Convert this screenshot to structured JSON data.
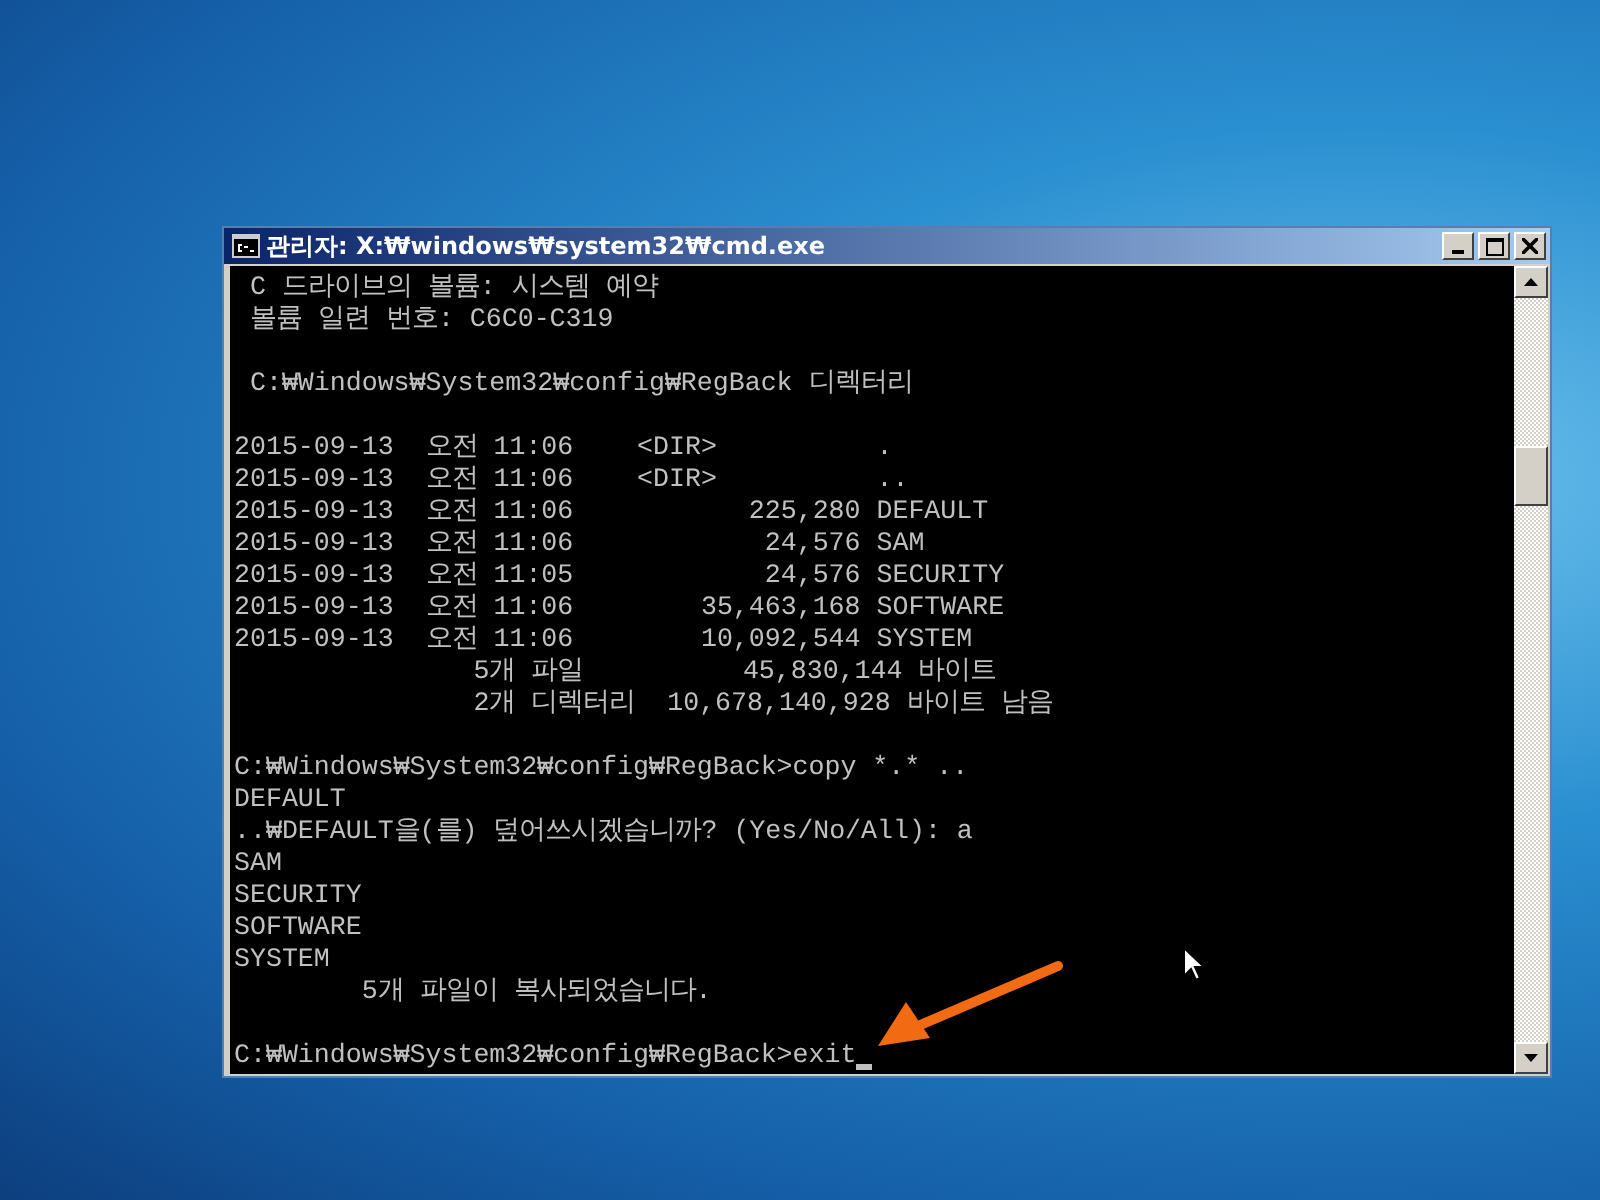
{
  "window": {
    "title": "관리자: X:₩windows₩system32₩cmd.exe"
  },
  "console": {
    "blocks": [
      [
        " C 드라이브의 볼륨: 시스템 예약",
        " 볼륨 일련 번호: C6C0-C319"
      ],
      [
        " C:₩Windows₩System32₩config₩RegBack 디렉터리"
      ],
      [
        "2015-09-13  오전 11:06    <DIR>          .",
        "2015-09-13  오전 11:06    <DIR>          ..",
        "2015-09-13  오전 11:06           225,280 DEFAULT",
        "2015-09-13  오전 11:06            24,576 SAM",
        "2015-09-13  오전 11:05            24,576 SECURITY",
        "2015-09-13  오전 11:06        35,463,168 SOFTWARE",
        "2015-09-13  오전 11:06        10,092,544 SYSTEM",
        "               5개 파일          45,830,144 바이트",
        "               2개 디렉터리  10,678,140,928 바이트 남음"
      ],
      [
        "C:₩Windows₩System32₩config₩RegBack>copy *.* ..",
        "DEFAULT",
        "..₩DEFAULT을(를) 덮어쓰시겠습니까? (Yes/No/All): a",
        "SAM",
        "SECURITY",
        "SOFTWARE",
        "SYSTEM",
        "        5개 파일이 복사되었습니다."
      ],
      [
        "C:₩Windows₩System32₩config₩RegBack>exit"
      ]
    ],
    "cursor_visible": true
  }
}
